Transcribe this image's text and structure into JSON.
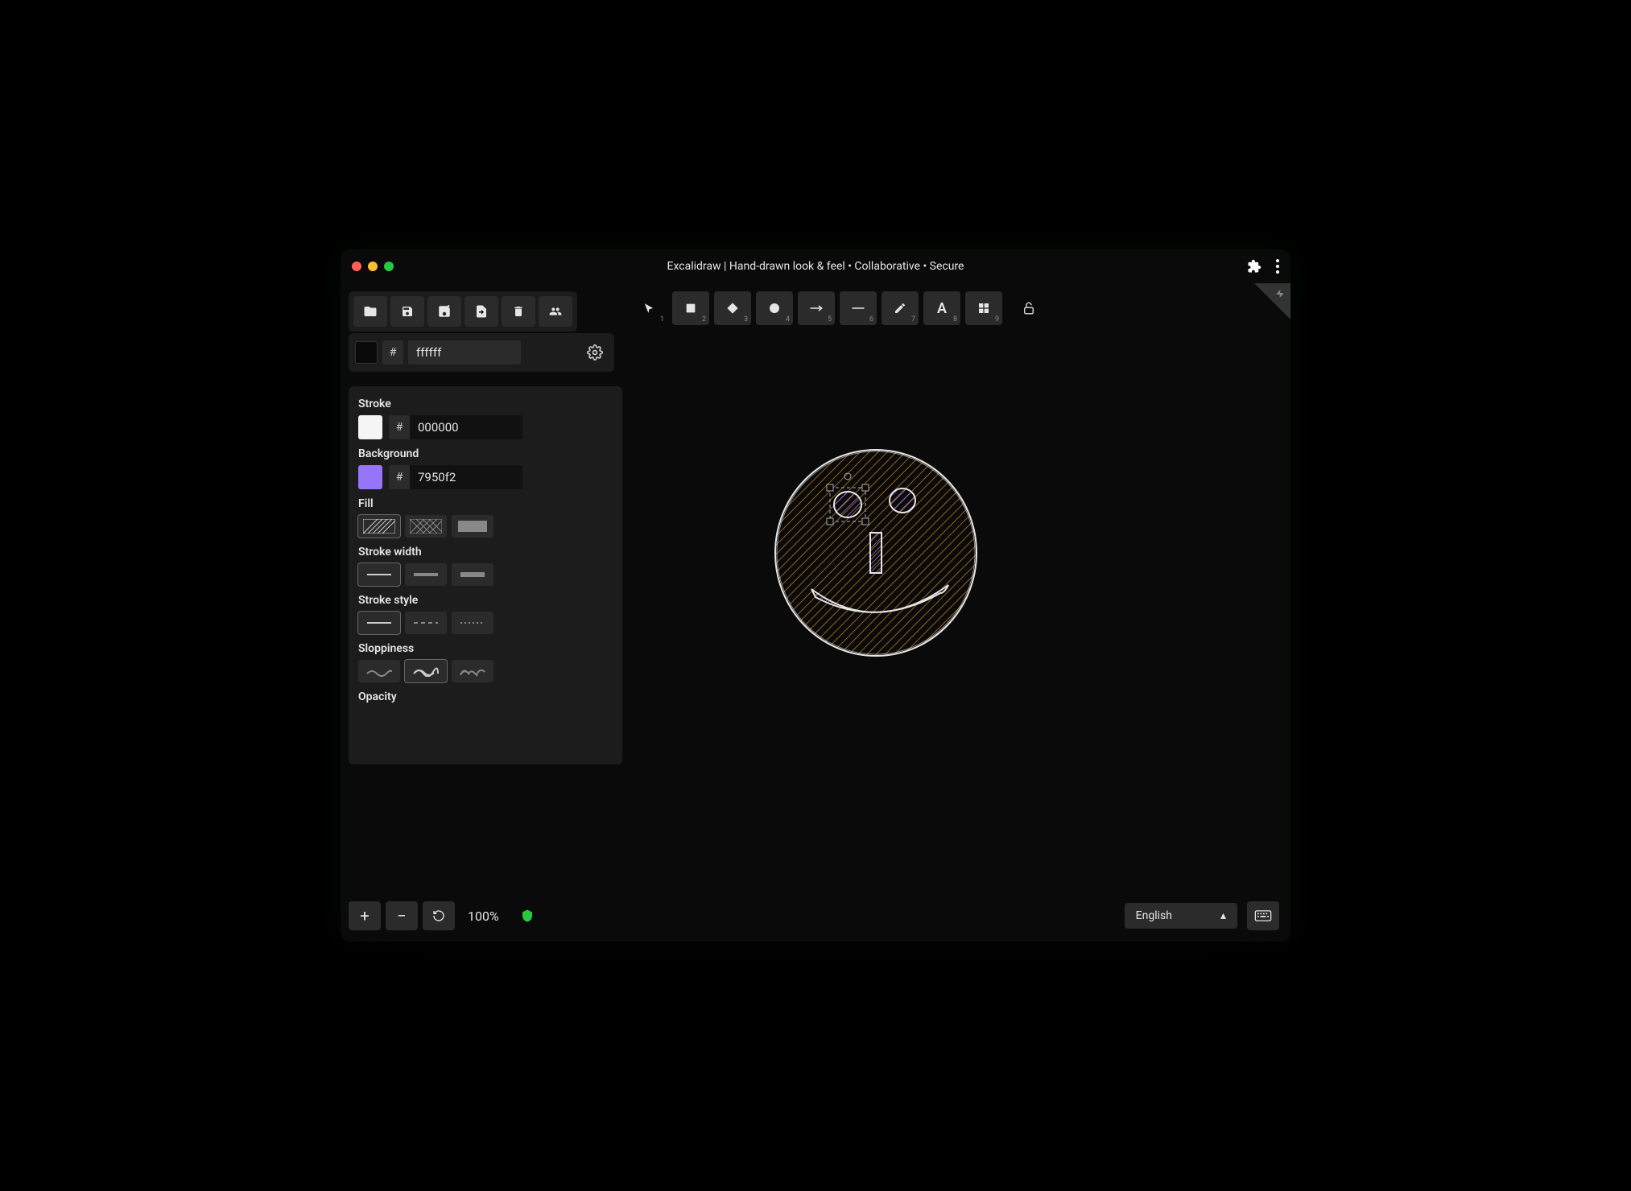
{
  "window": {
    "title": "Excalidraw | Hand-drawn look & feel • Collaborative • Secure"
  },
  "canvasColor": {
    "hash": "#",
    "value": "ffffff"
  },
  "tools": [
    {
      "name": "select",
      "num": "1"
    },
    {
      "name": "rectangle",
      "num": "2"
    },
    {
      "name": "diamond",
      "num": "3"
    },
    {
      "name": "ellipse",
      "num": "4"
    },
    {
      "name": "arrow",
      "num": "5"
    },
    {
      "name": "line",
      "num": "6"
    },
    {
      "name": "draw",
      "num": "7"
    },
    {
      "name": "text",
      "num": "8"
    },
    {
      "name": "library",
      "num": "9"
    }
  ],
  "props": {
    "stroke_label": "Stroke",
    "stroke_hash": "#",
    "stroke_value": "000000",
    "background_label": "Background",
    "background_hash": "#",
    "background_value": "7950f2",
    "fill_label": "Fill",
    "strokewidth_label": "Stroke width",
    "strokestyle_label": "Stroke style",
    "sloppiness_label": "Sloppiness",
    "opacity_label": "Opacity"
  },
  "zoom": {
    "level": "100%"
  },
  "language": {
    "selected": "English"
  }
}
